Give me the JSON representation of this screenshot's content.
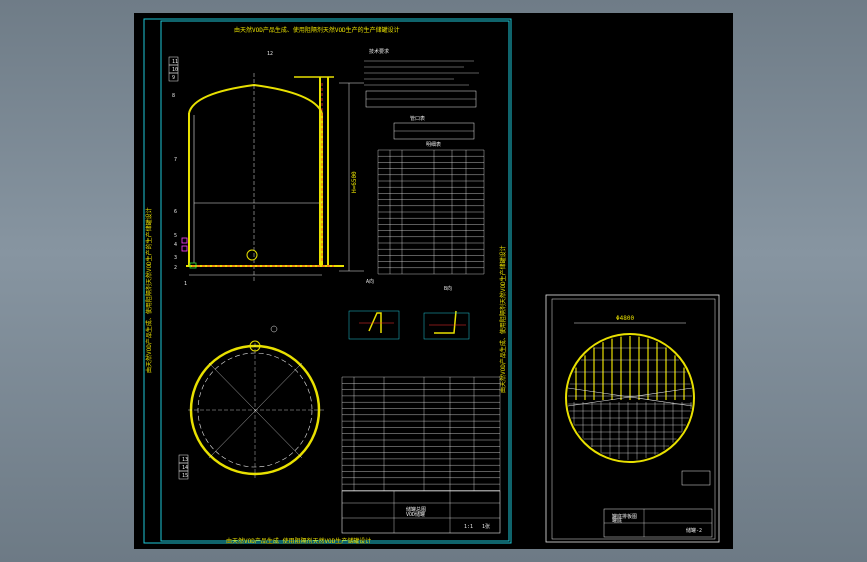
{
  "drawing": {
    "main_title_top": "由天然VOD产品生成、使用阻隔剂天然VOD生产的生产储罐设计",
    "main_title_bottom": "由天然VOD产品生成 使用阻隔剂天然VOD生产储罐设计",
    "side_text_left": "由天然VOD产品生成、使用阻隔剂天然VOD生产的生产储罐设计",
    "side_text_right": "由天然VOD产品生成、使用阻隔剂天然VOD生产储罐设计",
    "tech_title": "技术要求",
    "nozzle_title": "管口表",
    "parts_title": "明细表",
    "detail_a": "A向",
    "detail_b": "B向",
    "sheet_label": "1张",
    "scale_label": "1:1",
    "title_block_name": "储罐总图",
    "title_block_name2": "VOD储罐",
    "second_sheet_title": "罐底排板图",
    "second_sheet_code": "储罐-2",
    "second_sheet_name2": "罐底",
    "dimension_top": "Φ4800",
    "dimension_side": "H=6500"
  },
  "callouts": [
    "11",
    "10",
    "9",
    "8",
    "7",
    "6",
    "5",
    "4",
    "3",
    "2",
    "1",
    "12",
    "13",
    "14",
    "15"
  ],
  "colors": {
    "background": "#000000",
    "frame": "#1ec8d8",
    "tank": "#e8e000",
    "text": "#e8e8e8",
    "accent_red": "#ff3030"
  }
}
